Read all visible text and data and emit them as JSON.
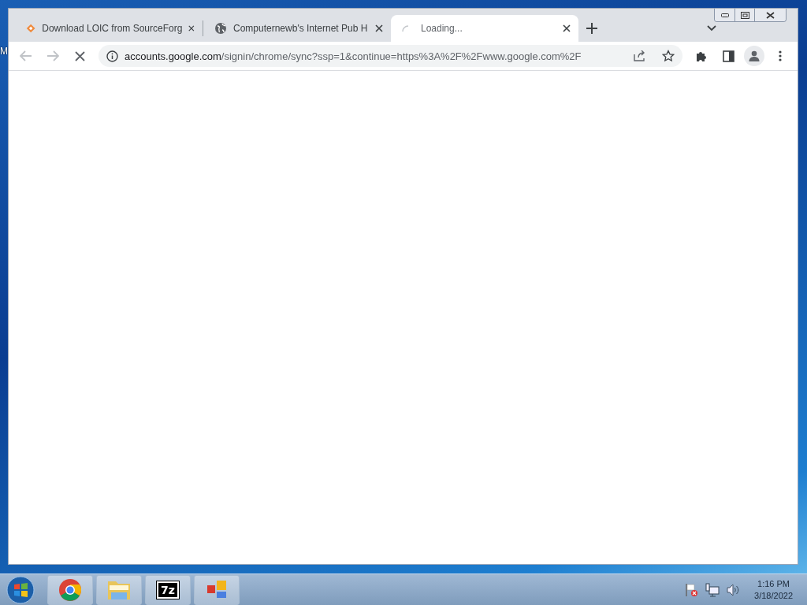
{
  "desktop": {
    "icon_label": "M"
  },
  "tabs": [
    {
      "title": "Download LOIC from SourceForg",
      "kind": "diamond",
      "loading": false,
      "selected": false
    },
    {
      "title": "Computernewb's Internet Pub H",
      "kind": "globe",
      "loading": false,
      "selected": false
    },
    {
      "title": "Loading...",
      "kind": "spinner",
      "loading": true,
      "selected": true
    }
  ],
  "toolbar": {
    "loading": true,
    "url": "accounts.google.com/signin/chrome/sync?ssp=1&continue=https%3A%2F%2Fwww.google.com%2F"
  },
  "taskbar": {
    "apps": [
      {
        "kind": "chrome"
      },
      {
        "kind": "folder"
      },
      {
        "kind": "sevenzip",
        "icon_text": "7z"
      },
      {
        "kind": "blocks"
      }
    ],
    "clock": {
      "time": "1:16 PM",
      "date": "3/18/2022"
    }
  }
}
